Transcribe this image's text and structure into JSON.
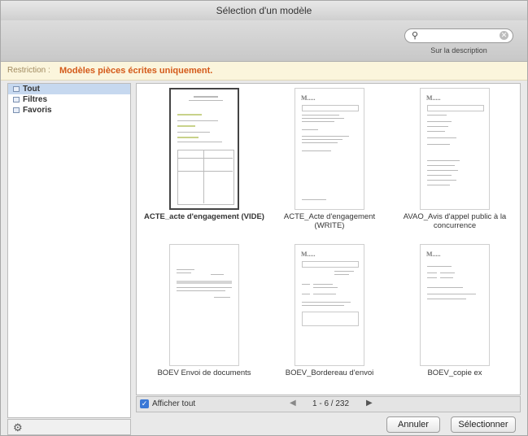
{
  "window": {
    "title": "Sélection d'un modèle"
  },
  "search": {
    "value": "",
    "icon": "search-icon",
    "subtitle": "Sur la description"
  },
  "restriction": {
    "label": "Restriction :",
    "text": "Modèles pièces écrites uniquement."
  },
  "sidebar": {
    "items": [
      {
        "label": "Tout",
        "selected": true
      },
      {
        "label": "Filtres",
        "selected": false
      },
      {
        "label": "Favoris",
        "selected": false
      }
    ]
  },
  "templates": [
    {
      "label": "ACTE_acte d'engagement (VIDE)",
      "selected": true
    },
    {
      "label": "ACTE_Acte d'engagement (WRITE)",
      "selected": false
    },
    {
      "label": "AVAO_Avis d'appel public à la concurrence",
      "selected": false
    },
    {
      "label": "BOEV Envoi de documents",
      "selected": false
    },
    {
      "label": "BOEV_Bordereau d'envoi",
      "selected": false
    },
    {
      "label": "BOEV_copie ex",
      "selected": false
    }
  ],
  "footer": {
    "show_all_label": "Afficher tout",
    "show_all_checked": true,
    "pager_prev": "◀",
    "pager_text": "1 - 6 / 232",
    "pager_next": "▶"
  },
  "buttons": {
    "cancel": "Annuler",
    "select": "Sélectionner"
  }
}
